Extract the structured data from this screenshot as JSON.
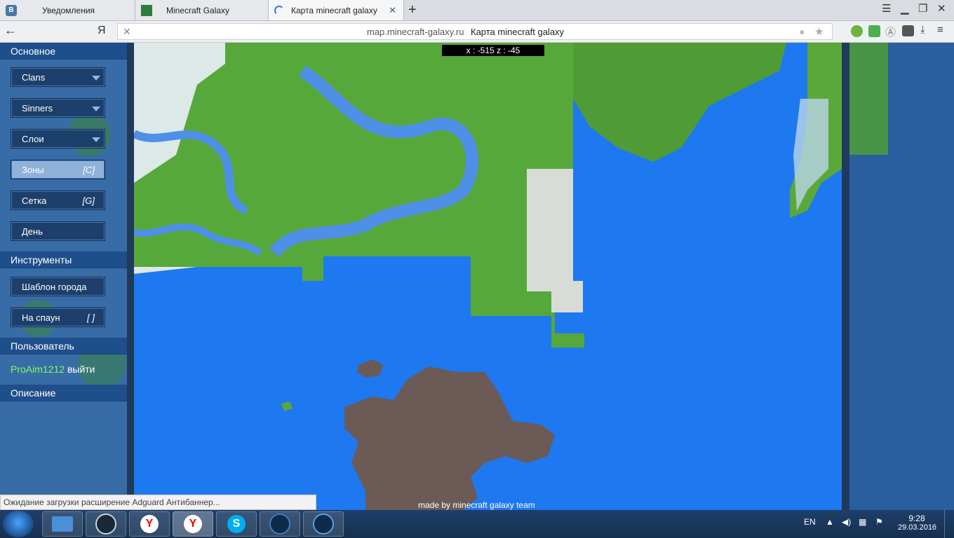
{
  "tabs": [
    {
      "label": "Уведомления",
      "favicon": "vk-icon"
    },
    {
      "label": "Minecraft Galaxy",
      "favicon": "creeper-icon"
    },
    {
      "label": "Карта minecraft galaxy",
      "favicon": "loading-spinner-icon"
    }
  ],
  "addressbar": {
    "url": "map.minecraft-galaxy.ru",
    "page_title": "Карта minecraft galaxy",
    "yandex_logo": "Я"
  },
  "sidebar": {
    "sections": {
      "main": "Основное",
      "tools": "Инструменты",
      "user": "Пользователь",
      "description": "Описание"
    },
    "dropdowns": [
      "Clans",
      "Sinners",
      "Слои"
    ],
    "toggles": [
      {
        "label": "Зоны",
        "shortcut": "[C]",
        "active": true
      },
      {
        "label": "Сетка",
        "shortcut": "[G]",
        "active": false
      },
      {
        "label": "День",
        "shortcut": "",
        "active": false
      }
    ],
    "tools": [
      {
        "label": "Шаблон города",
        "shortcut": ""
      },
      {
        "label": "На спаун",
        "shortcut": "[ ]"
      }
    ],
    "username": "ProAim1212",
    "logout": "выйти"
  },
  "map": {
    "coordinates": "x : -515 z : -45",
    "credits": "made by minecraft galaxy team"
  },
  "status_bar": "Ожидание загрузки расширение Adguard Антибаннер...",
  "taskbar": {
    "apps": [
      "folder-icon",
      "steam-icon",
      "yandex-browser-icon",
      "yandex-browser-active-icon",
      "skype-icon",
      "minecraft-launcher-icon",
      "minecraft-icon"
    ],
    "language": "EN",
    "time": "9:28",
    "date": "29.03.2016"
  },
  "colors": {
    "water": "#1e78f0",
    "grass": "#5aa83a",
    "snow": "#e4eef0",
    "stone": "#6b5a55",
    "sidebar": "#2a5f9f",
    "user_green": "#7dff5a"
  }
}
